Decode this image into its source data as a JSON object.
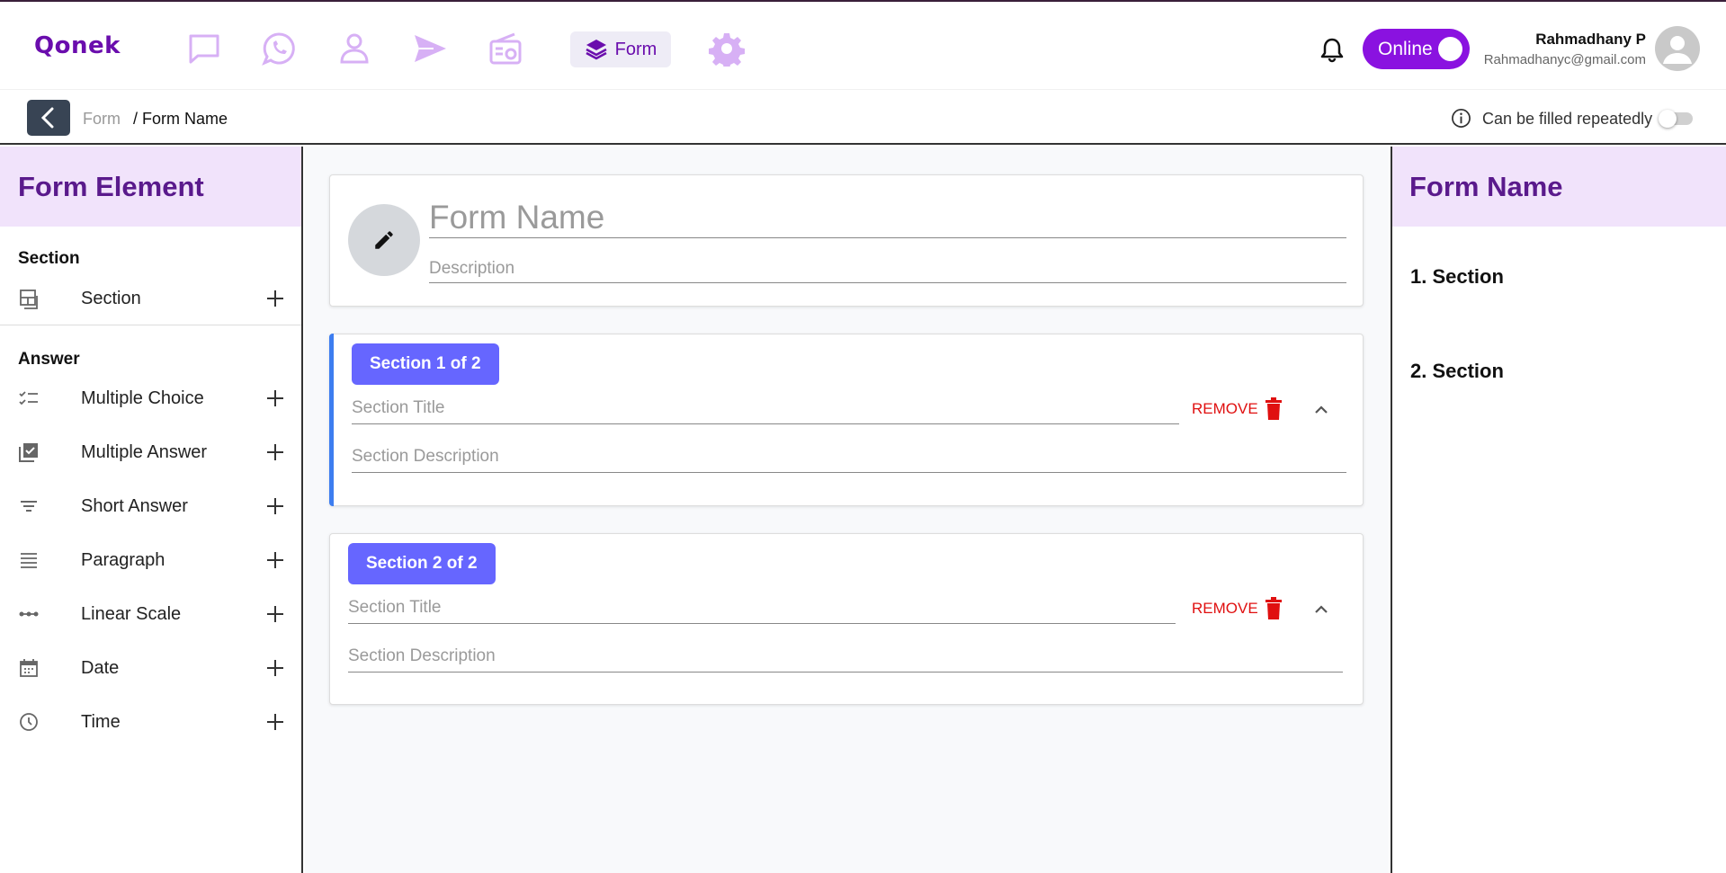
{
  "app": {
    "logo": "Qonek"
  },
  "nav": {
    "items": [
      {
        "name": "chat-icon"
      },
      {
        "name": "whatsapp-icon"
      },
      {
        "name": "contact-icon"
      },
      {
        "name": "send-icon"
      },
      {
        "name": "radio-icon"
      }
    ],
    "active_label": "Form",
    "settings_icon": "gear-icon",
    "accent_color": "#6a0dad",
    "icon_color": "#d7b0f5"
  },
  "status": {
    "label": "Online",
    "color": "#8a12e0"
  },
  "user": {
    "name": "Rahmadhany P",
    "email": "Rahmadhanyc@gmail.com"
  },
  "breadcrumb": {
    "parent": "Form",
    "current": "/ Form Name"
  },
  "repeat": {
    "label": "Can be filled repeatedly",
    "enabled": false
  },
  "left_panel": {
    "title": "Form Element",
    "groups": [
      {
        "title": "Section",
        "items": [
          {
            "label": "Section",
            "icon": "section-icon"
          }
        ]
      },
      {
        "title": "Answer",
        "items": [
          {
            "label": "Multiple Choice",
            "icon": "checklist-icon"
          },
          {
            "label": "Multiple Answer",
            "icon": "checkbox-stack-icon"
          },
          {
            "label": "Short Answer",
            "icon": "short-text-icon"
          },
          {
            "label": "Paragraph",
            "icon": "paragraph-icon"
          },
          {
            "label": "Linear Scale",
            "icon": "linear-scale-icon"
          },
          {
            "label": "Date",
            "icon": "calendar-icon"
          },
          {
            "label": "Time",
            "icon": "clock-icon"
          }
        ]
      }
    ]
  },
  "form": {
    "name_placeholder": "Form Name",
    "description_placeholder": "Description",
    "sections": [
      {
        "badge": "Section 1 of 2",
        "title_placeholder": "Section Title",
        "description_placeholder": "Section Description",
        "remove_label": "REMOVE"
      },
      {
        "badge": "Section 2 of 2",
        "title_placeholder": "Section Title",
        "description_placeholder": "Section Description",
        "remove_label": "REMOVE"
      }
    ],
    "badge_color": "#6666ff",
    "remove_color": "#e01010"
  },
  "right_panel": {
    "title": "Form Name",
    "toc": [
      "1. Section",
      "2. Section"
    ]
  }
}
